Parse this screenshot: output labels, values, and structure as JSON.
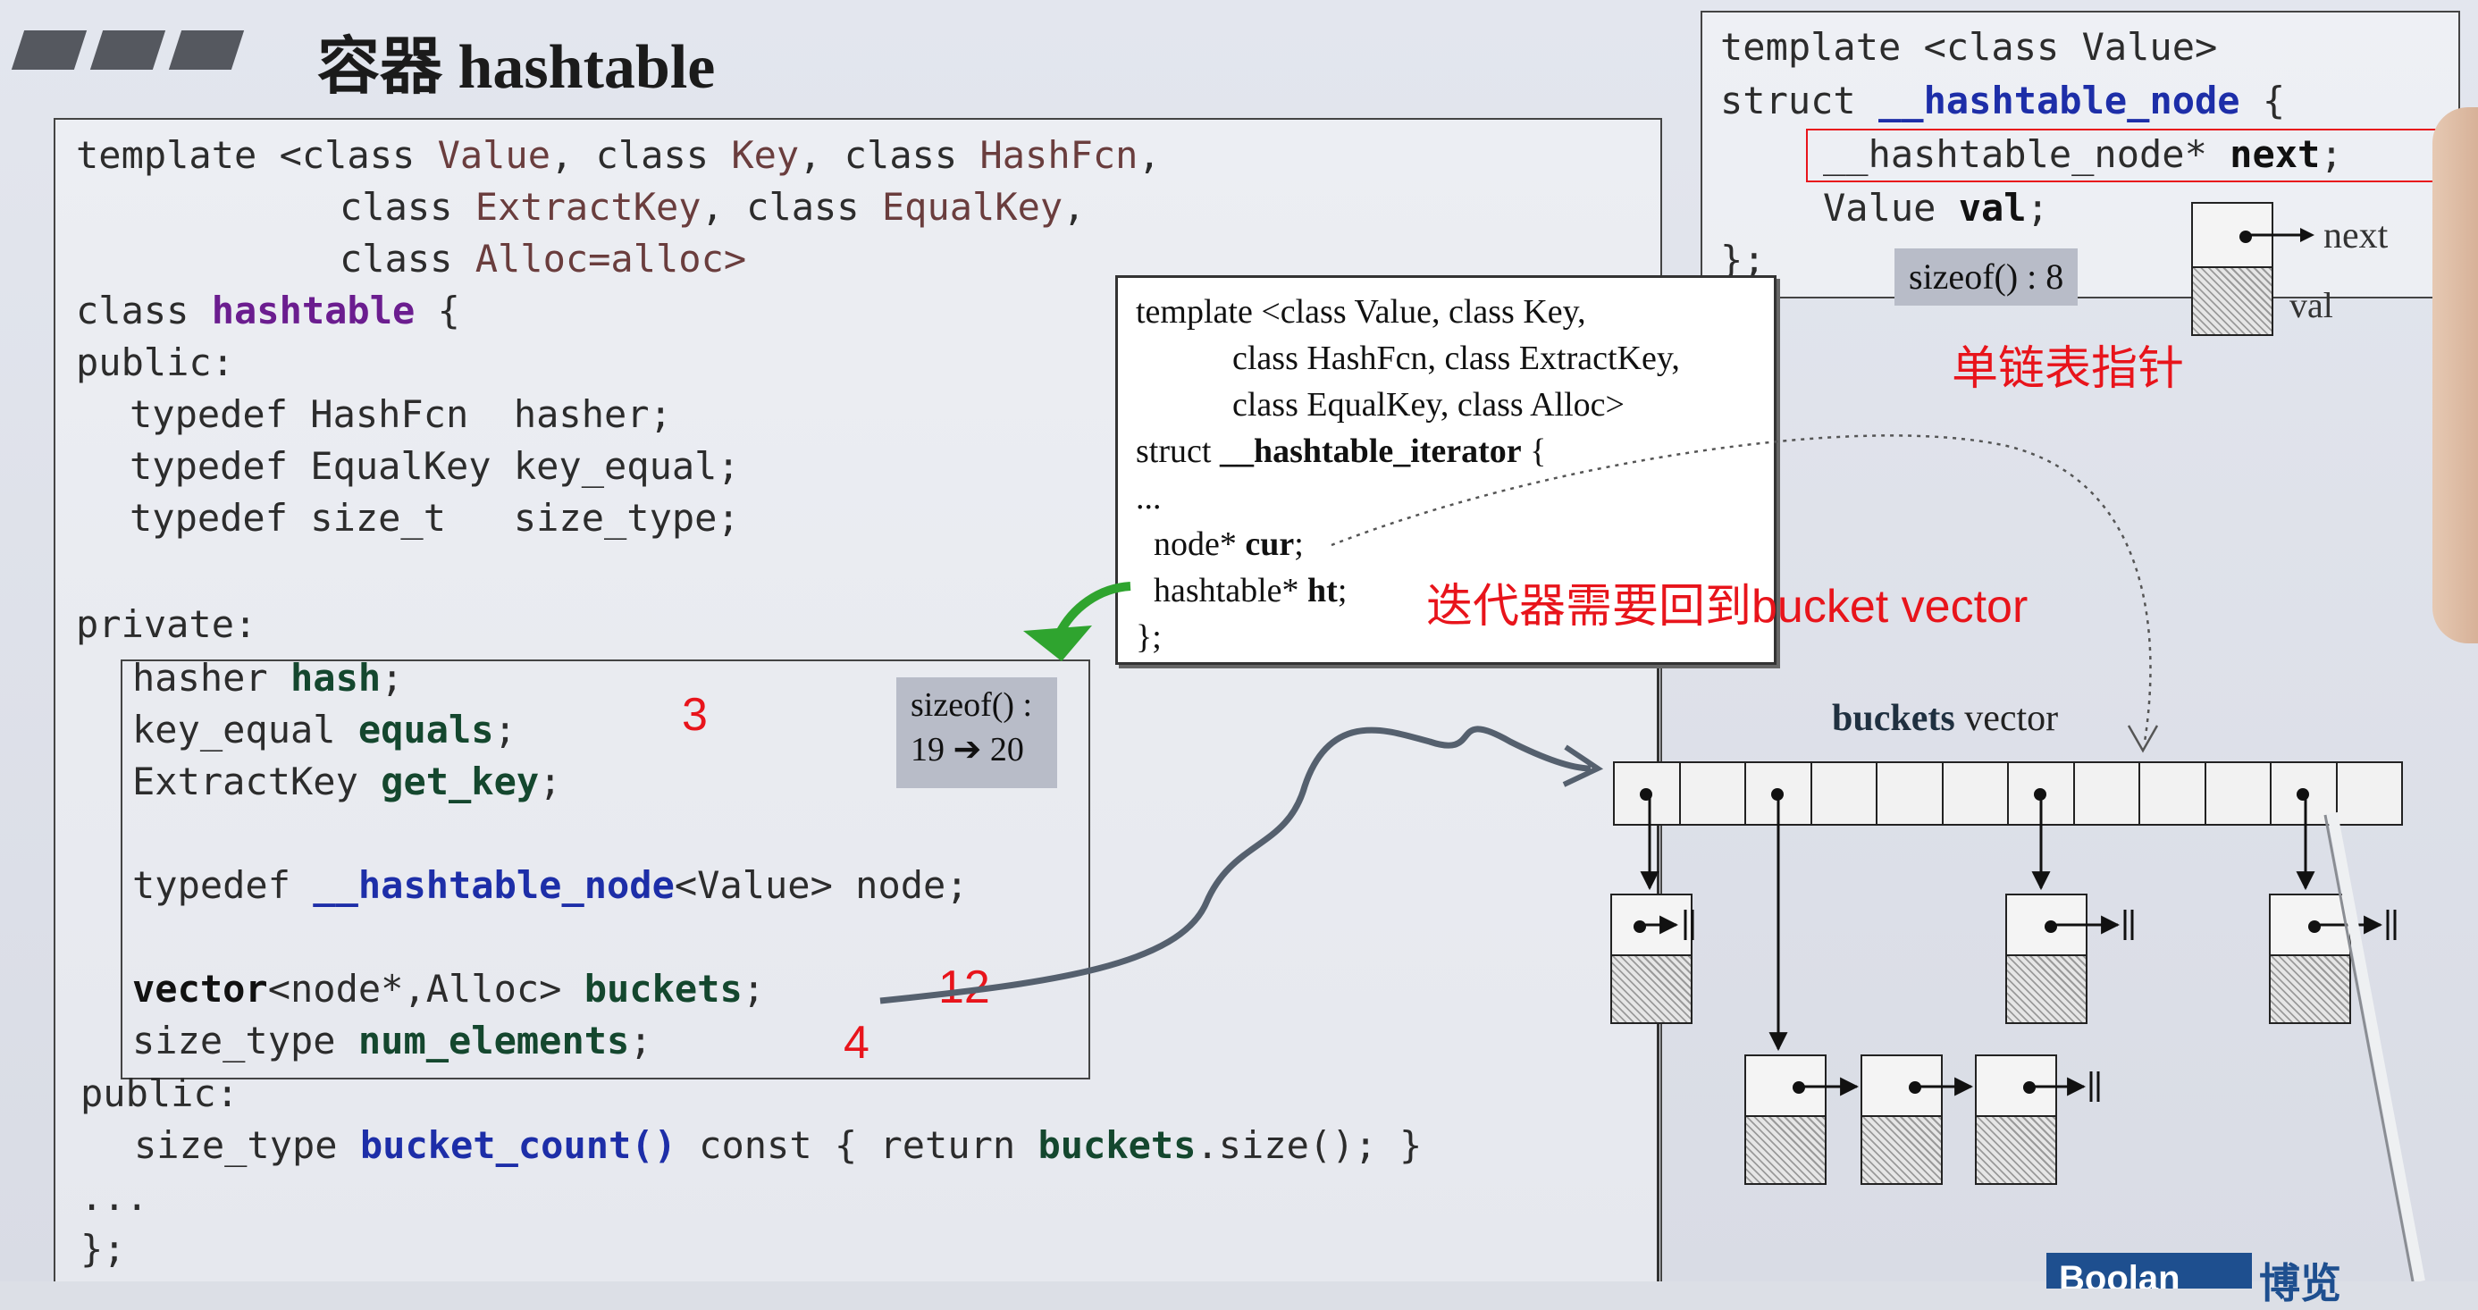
{
  "title": "容器 hashtable",
  "main_code": {
    "template_line1_pre": "template <class ",
    "value": "Value",
    "comma_class1": ", class ",
    "key": "Key",
    "comma_class2": ", class ",
    "hashfcn": "HashFcn",
    "comma_end": ",",
    "line2_class": "class ",
    "extractkey": "ExtractKey",
    "line2_mid": ", class ",
    "equalkey": "EqualKey",
    "line2_end": ",",
    "line3_class": "class ",
    "alloc": "Alloc=alloc>",
    "class_kw": "class ",
    "hashtable": "hashtable",
    "brace": " {",
    "public1": "public:",
    "td1": "typedef HashFcn  hasher;",
    "td2": "typedef EqualKey key_equal;",
    "td3": "typedef size_t   size_type;",
    "private": "private:",
    "p1a": "hasher ",
    "p1b": "hash",
    "p1c": ";",
    "p2a": "key_equal ",
    "p2b": "equals",
    "p2c": ";",
    "p3a": "ExtractKey ",
    "p3b": "get_key",
    "p3c": ";",
    "p4a": "typedef ",
    "p4b": "__hashtable_node",
    "p4c": "<Value> node;",
    "p5a": "vector",
    "p5b": "<node*,Alloc> ",
    "p5c": "buckets",
    "p5d": ";",
    "p6a": "size_type ",
    "p6b": "num_elements",
    "p6c": ";",
    "public2": "public:",
    "bc_a": "size_type ",
    "bc_b": "bucket_count()",
    "bc_c": " const { return ",
    "bc_d": "buckets",
    "bc_e": ".size(); }",
    "dots": "...",
    "end": "};"
  },
  "sizeof_main": {
    "line1": "sizeof() :",
    "line2": "19 ➔ 20"
  },
  "annotations": {
    "n3": "3",
    "n12": "12",
    "n4": "4",
    "iter_note": "迭代器需要回到bucket vector",
    "node_note": "单链表指针"
  },
  "iterator_box": {
    "l1": "template <class Value, class Key,",
    "l2": "class HashFcn, class ExtractKey,",
    "l3": "class EqualKey, class Alloc>",
    "l4a": "struct ",
    "l4b": "__hashtable_iterator",
    "l4c": " {",
    "l5": "...",
    "l6a": "node* ",
    "l6b": "cur",
    "l6c": ";",
    "l7a": "hashtable* ",
    "l7b": "ht",
    "l7c": ";",
    "l8": "};"
  },
  "node_box": {
    "l1": "template <class Value>",
    "l2a": "struct ",
    "l2b": "__hashtable_node",
    "l2c": " {",
    "l3a": "__hashtable_node* ",
    "l3b": "next",
    "l3c": ";",
    "l4a": "Value ",
    "l4b": "val",
    "l4c": ";",
    "l5": "};",
    "sizeof": "sizeof() : 8",
    "next_label": "next",
    "val_label": "val"
  },
  "buckets_label": {
    "a": "buckets",
    "b": " vector"
  },
  "logo": {
    "a": "Boolan",
    "b": "博览"
  }
}
